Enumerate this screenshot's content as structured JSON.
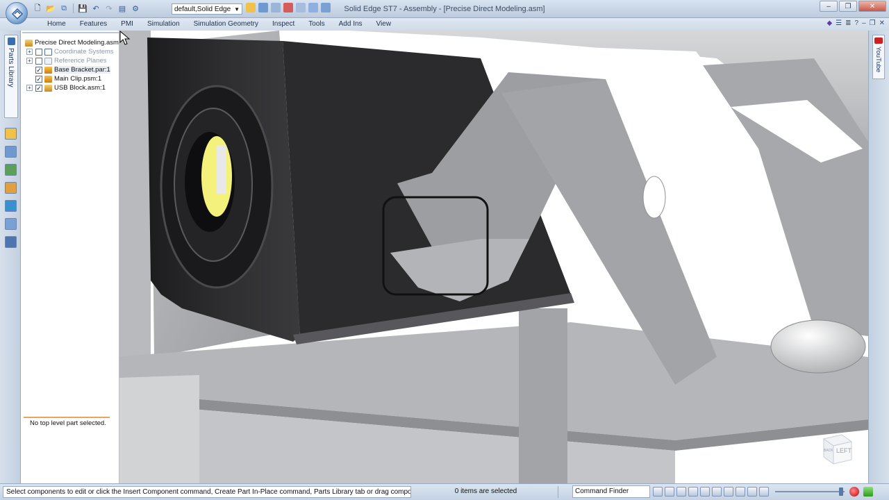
{
  "titlebar": {
    "title": "Solid Edge ST7 - Assembly - [Precise Direct Modeling.asm]",
    "environment": "default,Solid Edge",
    "min_glyph": "–",
    "max_glyph": "❐",
    "close_glyph": "✕"
  },
  "ribbon": {
    "tabs": [
      {
        "label": "Home"
      },
      {
        "label": "Features"
      },
      {
        "label": "PMI"
      },
      {
        "label": "Simulation"
      },
      {
        "label": "Simulation Geometry"
      },
      {
        "label": "Inspect"
      },
      {
        "label": "Tools"
      },
      {
        "label": "Add Ins"
      },
      {
        "label": "View"
      }
    ]
  },
  "left_strip": {
    "parts_library_label": "Parts Library"
  },
  "pathfinder": {
    "root": "Precise Direct Modeling.asm",
    "items": [
      {
        "label": "Coordinate Systems",
        "checked": false,
        "dim": true,
        "expandable": true
      },
      {
        "label": "Reference Planes",
        "checked": false,
        "dim": true,
        "expandable": false
      },
      {
        "label": "Base Bracket.par:1",
        "checked": true,
        "dim": false,
        "expandable": false
      },
      {
        "label": "Main Clip.psm:1",
        "checked": true,
        "dim": false,
        "expandable": false
      },
      {
        "label": "USB Block.asm:1",
        "checked": true,
        "dim": false,
        "expandable": true
      }
    ],
    "status": "No top level part selected."
  },
  "viewport": {
    "view_cube_label": "LEFT",
    "view_cube_side": "BACK"
  },
  "right_strip": {
    "youtube_label": "YouTube"
  },
  "statusbar": {
    "prompt": "Select components to edit or click the Insert Component command, Create Part In-Place command, Parts Library tab or drag components",
    "selection_count": "0 items are selected",
    "command_finder": "Command Finder"
  },
  "colors": {
    "accent": "#3a6cb0",
    "bracket_gray": "#a9aaad",
    "block_dark": "#2a2a2c",
    "usb_yellow": "#f4f27a"
  }
}
